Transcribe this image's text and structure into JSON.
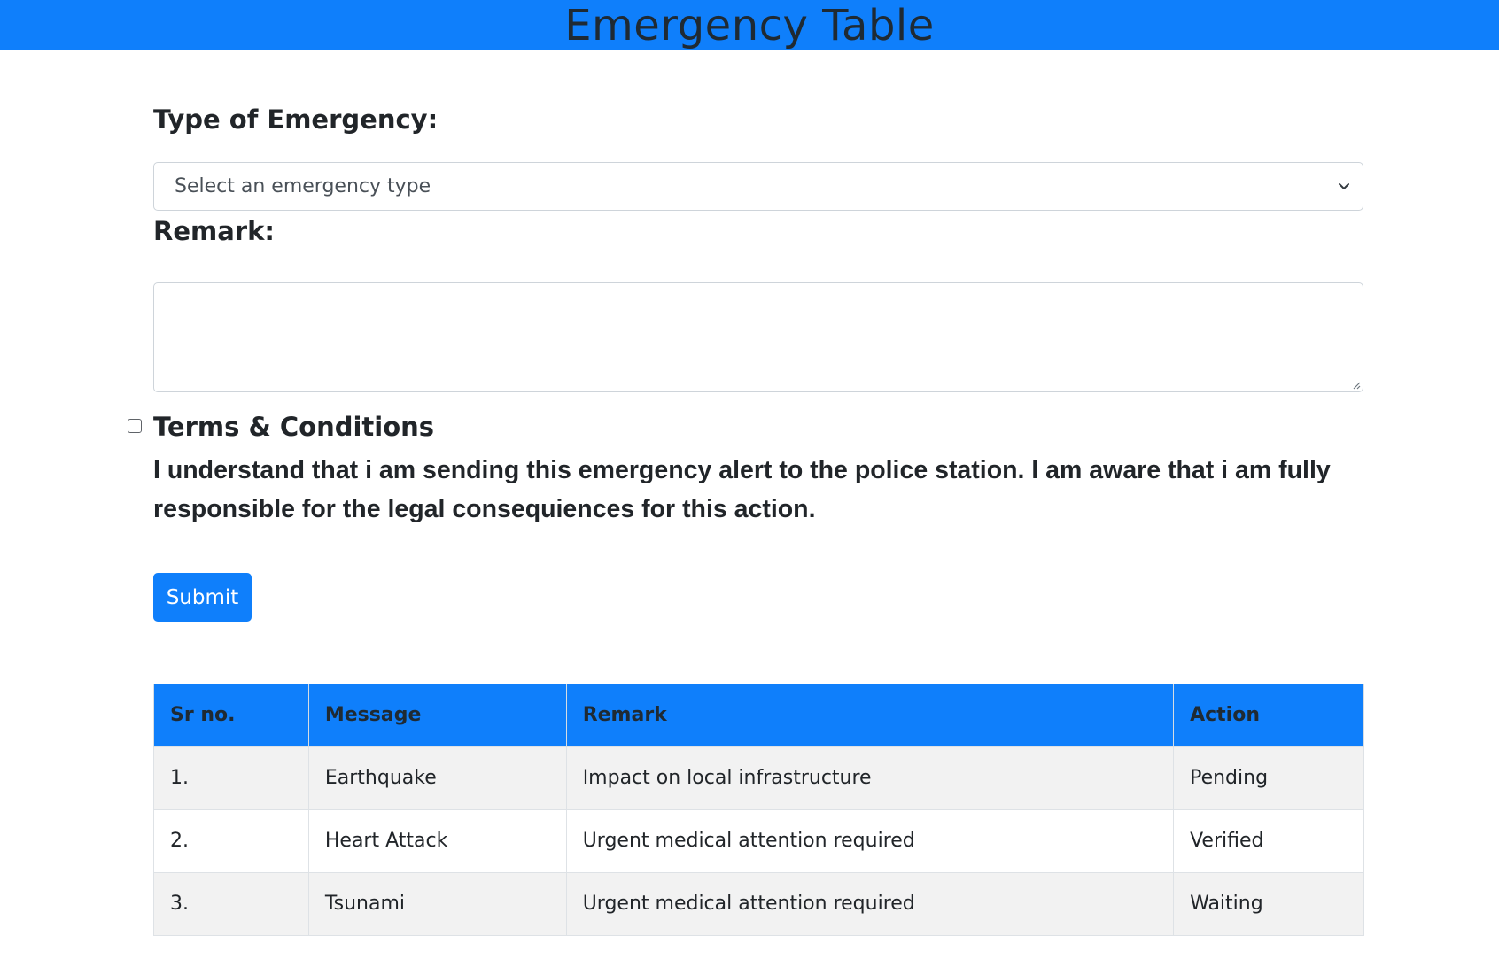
{
  "header": {
    "title": "Emergency Table"
  },
  "form": {
    "type_label": "Type of Emergency:",
    "type_placeholder": "Select an emergency type",
    "remark_label": "Remark:",
    "remark_value": "",
    "terms_title": "Terms & Conditions",
    "terms_text": "I understand that i am sending this emergency alert to the police station. I am aware that i am fully responsible for the legal consequiences for this action.",
    "terms_checked": false,
    "submit_label": "Submit"
  },
  "table": {
    "headers": [
      "Sr no.",
      "Message",
      "Remark",
      "Action"
    ],
    "rows": [
      [
        "1.",
        "Earthquake",
        "Impact on local infrastructure",
        "Pending"
      ],
      [
        "2.",
        "Heart Attack",
        "Urgent medical attention required",
        "Verified"
      ],
      [
        "3.",
        "Tsunami",
        "Urgent medical attention required",
        "Waiting"
      ]
    ]
  },
  "colors": {
    "accent": "#0f7ffb",
    "stripe": "#f2f2f2"
  },
  "icons": {
    "select_chevron": "chevron-down-icon",
    "textarea_resize": "resize-handle-icon"
  }
}
